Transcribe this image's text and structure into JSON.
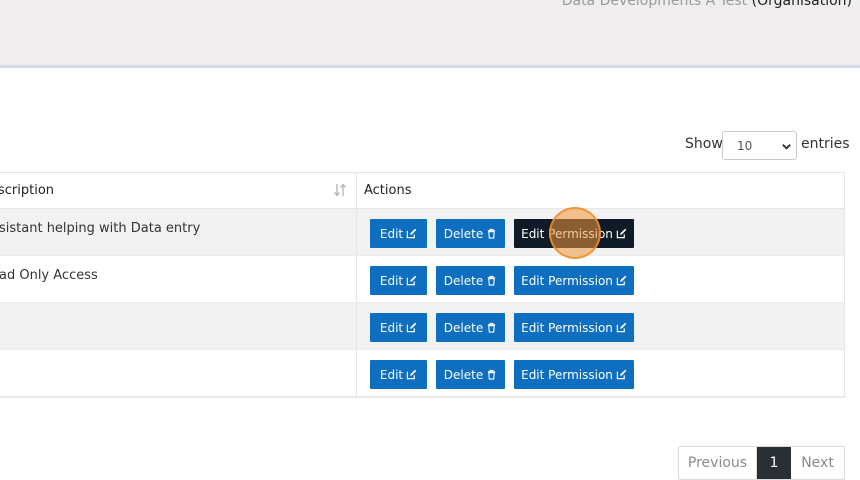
{
  "header": {
    "org_name": "Data Developments A Test",
    "org_type": "(Organisation)"
  },
  "length_control": {
    "show_label": "Show",
    "selected": "10",
    "entries_label": "entries"
  },
  "table": {
    "columns": {
      "description": "scription",
      "actions": "Actions"
    },
    "rows": [
      {
        "description": "sistant helping with Data entry"
      },
      {
        "description": "ad Only Access"
      },
      {
        "description": ""
      },
      {
        "description": ""
      }
    ],
    "buttons": {
      "edit": "Edit",
      "delete": "Delete",
      "edit_permission": "Edit Permission"
    }
  },
  "pagination": {
    "previous": "Previous",
    "current": "1",
    "next": "Next"
  },
  "colors": {
    "primary_button": "#0e6ebf",
    "active_button": "#0f1b27",
    "current_page": "#2a2f35"
  },
  "icons": [
    "chevron-down-icon",
    "sort-icon",
    "edit-icon",
    "trash-icon"
  ]
}
